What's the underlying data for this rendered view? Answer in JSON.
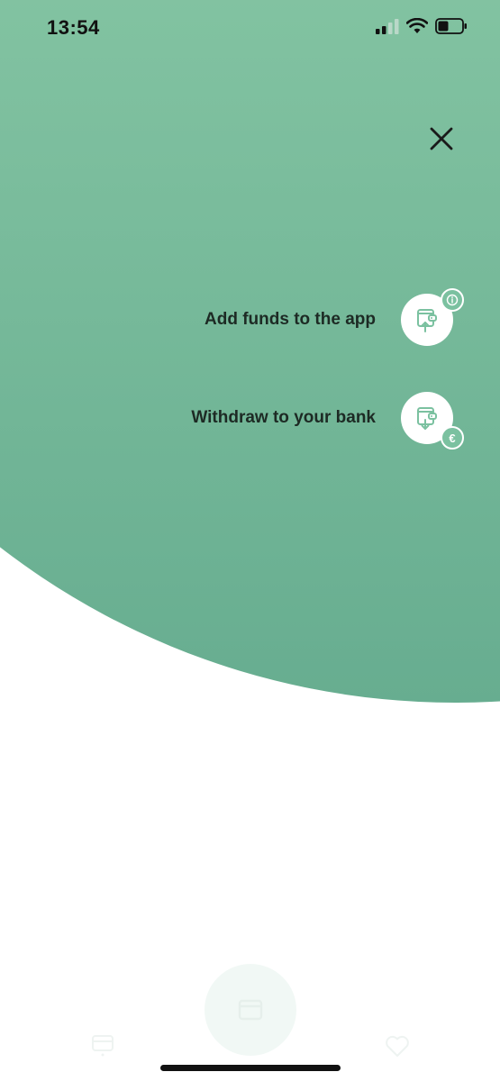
{
  "status_bar": {
    "time": "13:54"
  },
  "actions": [
    {
      "label": "Add funds to the app",
      "icon": "wallet-upload-icon",
      "badge_icon": "info-icon"
    },
    {
      "label": "Withdraw to your bank",
      "icon": "wallet-download-icon",
      "badge_icon": "euro-icon",
      "badge_text": "€"
    }
  ],
  "colors": {
    "green_top": "#8fcdab",
    "green_bottom": "#67ad90",
    "badge": "#7bc1a0",
    "label_text": "#1d2a24"
  }
}
